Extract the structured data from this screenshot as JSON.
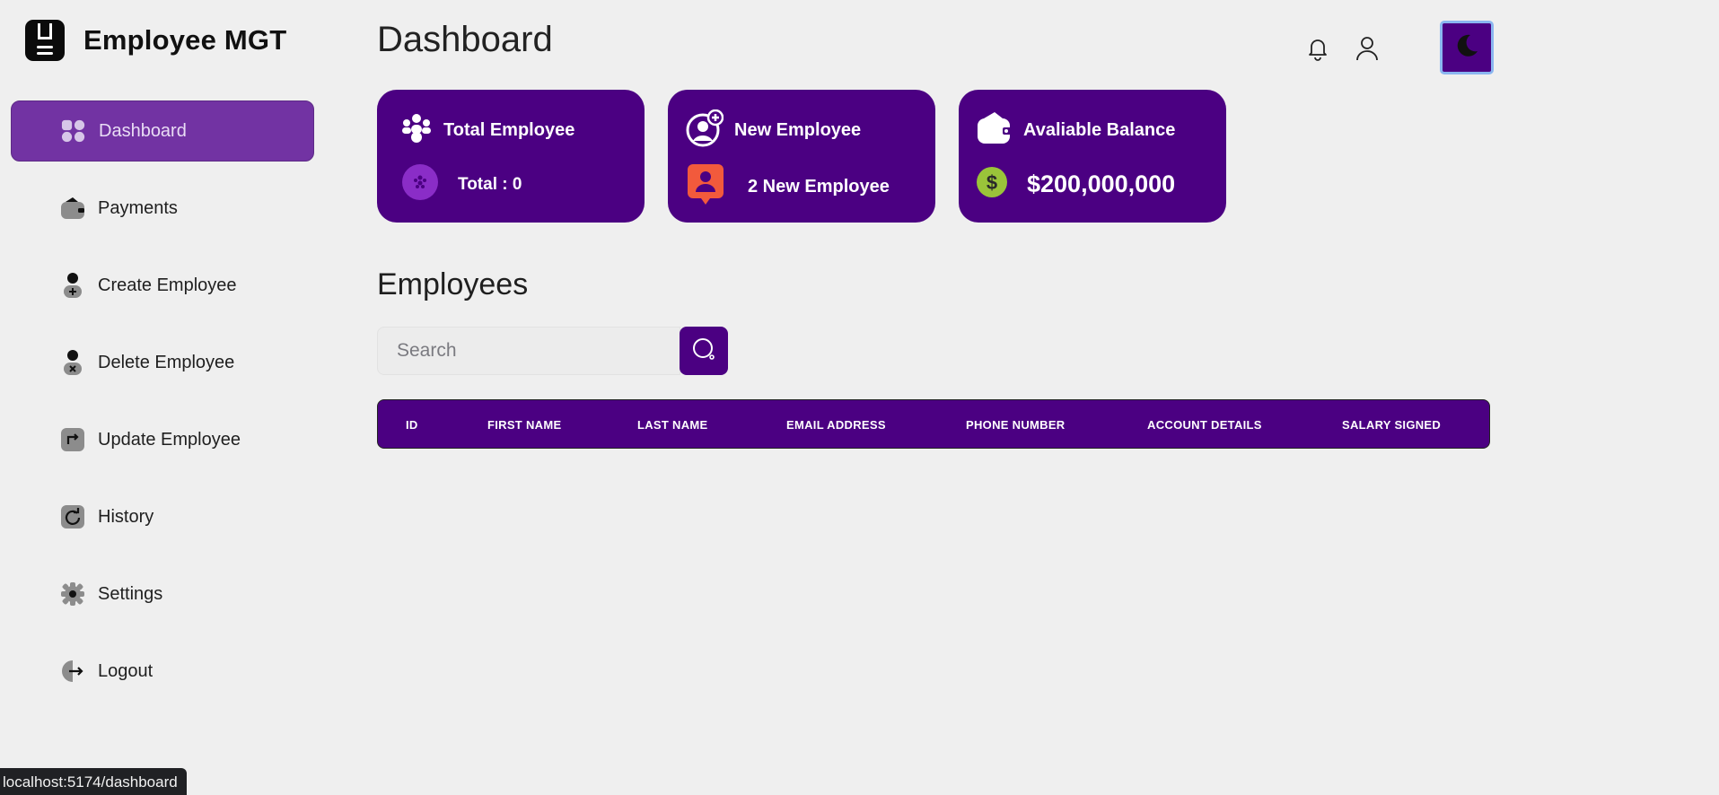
{
  "brand": {
    "title": "Employee MGT"
  },
  "sidebar": {
    "items": [
      {
        "label": "Dashboard",
        "icon": "dashboard-icon",
        "active": true
      },
      {
        "label": "Payments",
        "icon": "wallet-icon"
      },
      {
        "label": "Create Employee",
        "icon": "user-add-icon"
      },
      {
        "label": "Delete Employee",
        "icon": "user-remove-icon"
      },
      {
        "label": "Update Employee",
        "icon": "update-icon"
      },
      {
        "label": "History",
        "icon": "history-icon"
      },
      {
        "label": "Settings",
        "icon": "settings-icon"
      },
      {
        "label": "Logout",
        "icon": "logout-icon"
      }
    ]
  },
  "header": {
    "title": "Dashboard"
  },
  "cards": [
    {
      "title": "Total Employee",
      "value": "Total : 0",
      "icon": "users-icon"
    },
    {
      "title": "New Employee",
      "value": "2 New Employee",
      "icon": "user-plus-icon"
    },
    {
      "title": "Avaliable Balance",
      "value": "$200,000,000",
      "icon": "wallet-icon"
    }
  ],
  "employees": {
    "title": "Employees",
    "search_placeholder": "Search",
    "columns": [
      "ID",
      "FIRST NAME",
      "LAST NAME",
      "EMAIL ADDRESS",
      "PHONE NUMBER",
      "ACCOUNT DETAILS",
      "SALARY SIGNED"
    ]
  },
  "status_bar": {
    "url": "localhost:5174/dashboard"
  },
  "colors": {
    "primary": "#4b0082",
    "active_nav": "#7233a3",
    "background": "#efefef",
    "money_badge": "#9ac43a",
    "new_badge": "#f25a3c",
    "total_badge": "#8a2dc7"
  }
}
